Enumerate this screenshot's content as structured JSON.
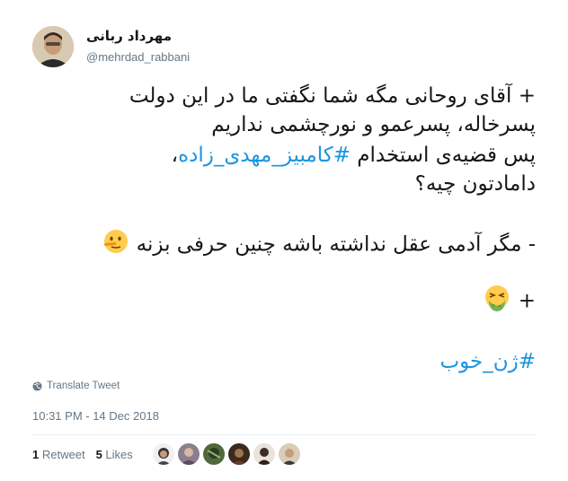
{
  "author": {
    "display_name": "مهرداد ربانی",
    "username": "@mehrdad_rabbani"
  },
  "tweet": {
    "line1": "+ آقای روحانی مگه شما نگفتی ما در این دولت",
    "line2": "پسرخاله، پسرعمو و نورچشمی نداریم",
    "line3_prefix": "پس قضیه‌ی استخدام",
    "line3_hashtag": "#کامبیز_مهدی_زاده",
    "line3_suffix": "،",
    "line4": "دامادتون چیه؟",
    "line5": "- مگر آدمی عقل نداشته باشه چنین حرفی بزنه",
    "line6": "+",
    "hashtag2": "#ژن_خوب",
    "emoji1": "lying-face-emoji",
    "emoji2": "nauseated-face-emoji"
  },
  "translate_label": "Translate Tweet",
  "timestamp": "10:31 PM - 14 Dec 2018",
  "stats": {
    "retweet_count": "1",
    "retweet_label": "Retweet",
    "like_count": "5",
    "like_label": "Likes"
  },
  "liker_avatars": [
    "liker-1",
    "liker-2",
    "liker-3",
    "liker-4",
    "liker-5",
    "liker-6"
  ],
  "colors": {
    "hashtag": "#1b95e0",
    "text": "#14171a",
    "secondary": "#657786",
    "divider": "#e6ecf0"
  }
}
